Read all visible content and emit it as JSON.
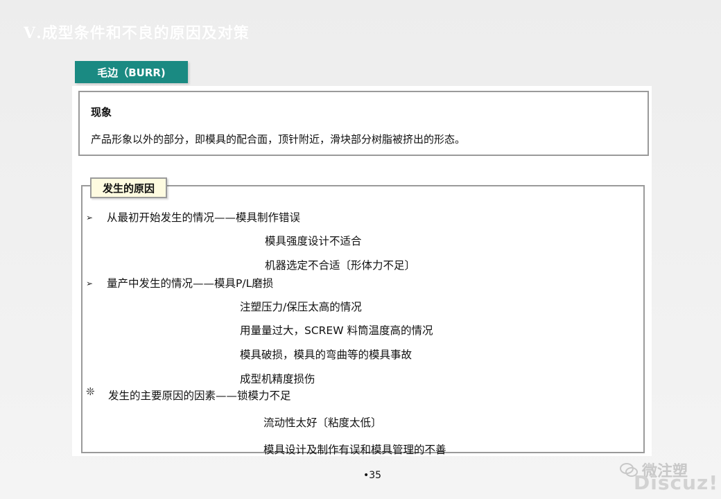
{
  "slide": {
    "title": "Ⅴ.成型条件和不良的原因及对策",
    "tag": "毛边（BURR)",
    "page_number": "•35"
  },
  "phenomenon": {
    "title": "现象",
    "text": "产品形象以外的部分，即模具的配合面，顶针附近，滑块部分树脂被挤出的形态。"
  },
  "causes": {
    "label": "发生的原因",
    "lines": [
      "从最初开始发生的情况——模具制作错误",
      "模具强度设计不适合",
      "机器选定不合适〔形体力不足〕",
      "量产中发生的情况——模具P/L磨损",
      "注塑压力/保压太高的情况",
      "用量量过大，SCREW  料筒温度高的情况",
      "模具破损，模具的弯曲等的模具事故",
      "成型机精度损伤",
      "发生的主要原因的因素——锁模力不足",
      "流动性太好〔粘度太低〕",
      "模具设计及制作有误和模具管理的不善"
    ],
    "bullet_arrow": "➢",
    "bullet_star": "❊"
  },
  "watermark": {
    "line1": "微注塑",
    "line2": "Discuz!"
  }
}
